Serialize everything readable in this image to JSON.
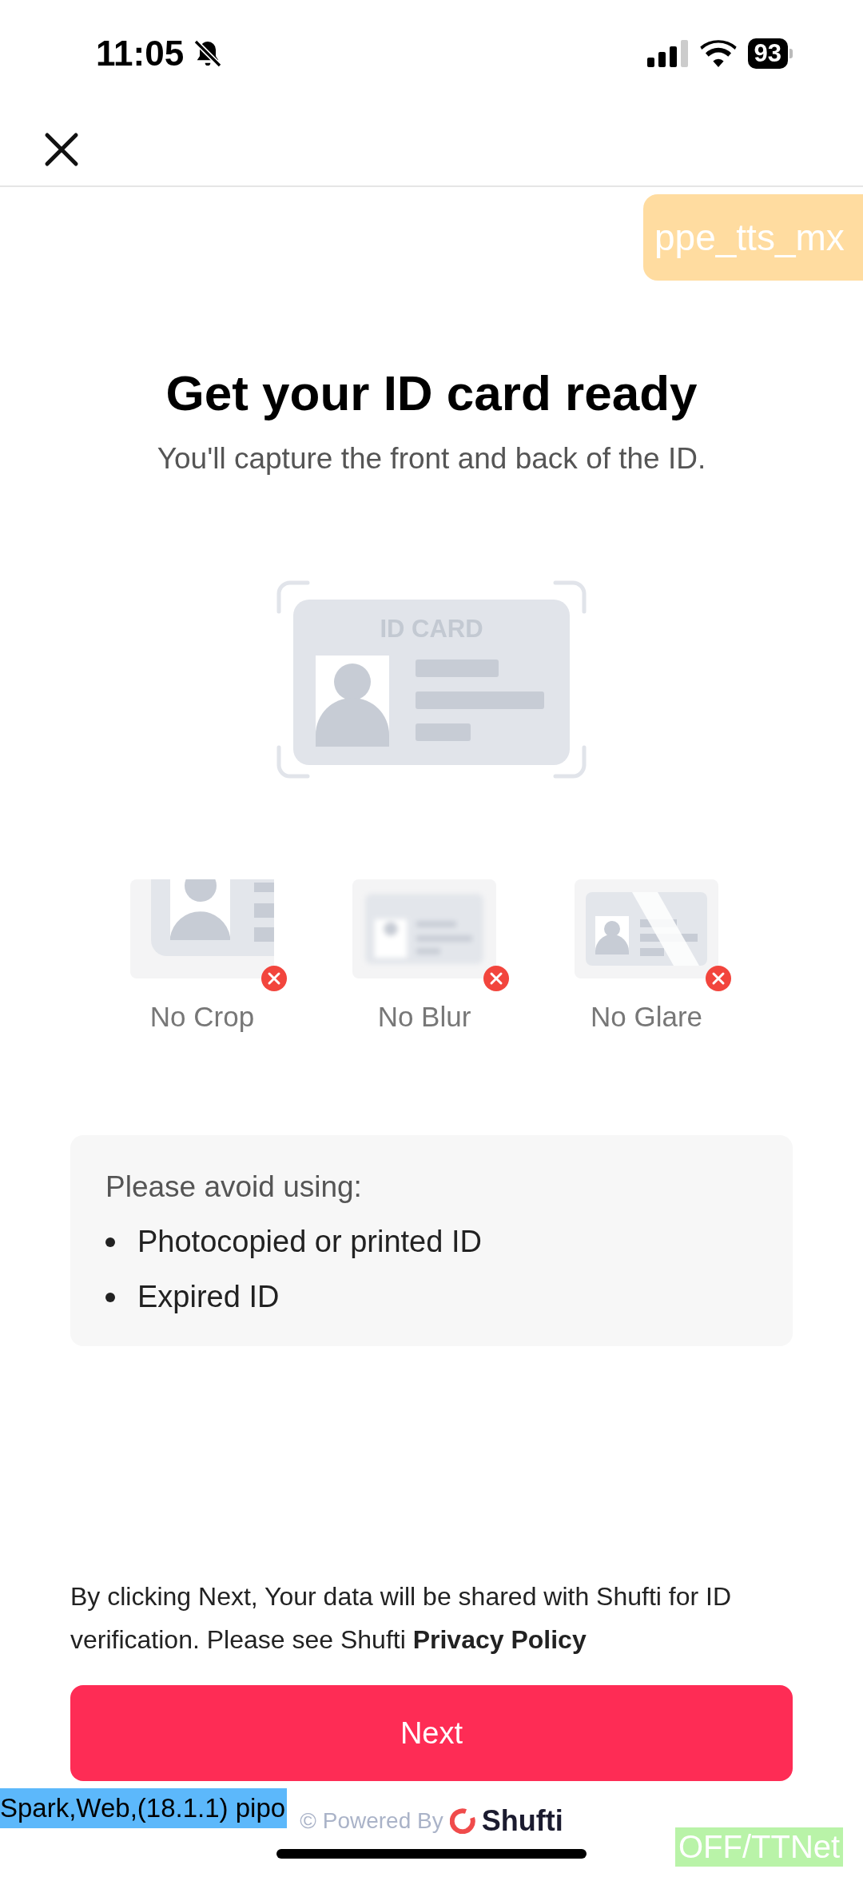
{
  "status_bar": {
    "time": "11:05",
    "battery": "93"
  },
  "debug_overlays": [
    {
      "kind": "env",
      "text": "ppe_tts_mx"
    },
    {
      "kind": "build",
      "text": "Spark,Web,(18.1.1) pipo"
    },
    {
      "kind": "network",
      "text": "OFF/TTNet"
    }
  ],
  "title": "Get your ID card ready",
  "subtitle": "You'll capture the front and back of the ID.",
  "card_label": "ID CARD",
  "examples": [
    {
      "kind": "crop",
      "label": "No Crop"
    },
    {
      "kind": "blur",
      "label": "No Blur"
    },
    {
      "kind": "glare",
      "label": "No Glare"
    }
  ],
  "avoid": {
    "heading": "Please avoid using:",
    "items": [
      "Photocopied or printed ID",
      "Expired ID"
    ]
  },
  "disclaimer": "By clicking Next, Your data will be shared with Shufti for ID verification. Please see Shufti **Privacy Policy**",
  "next_button": "Next",
  "powered_by": {
    "text": "© Powered By",
    "brand": "Shufti"
  }
}
